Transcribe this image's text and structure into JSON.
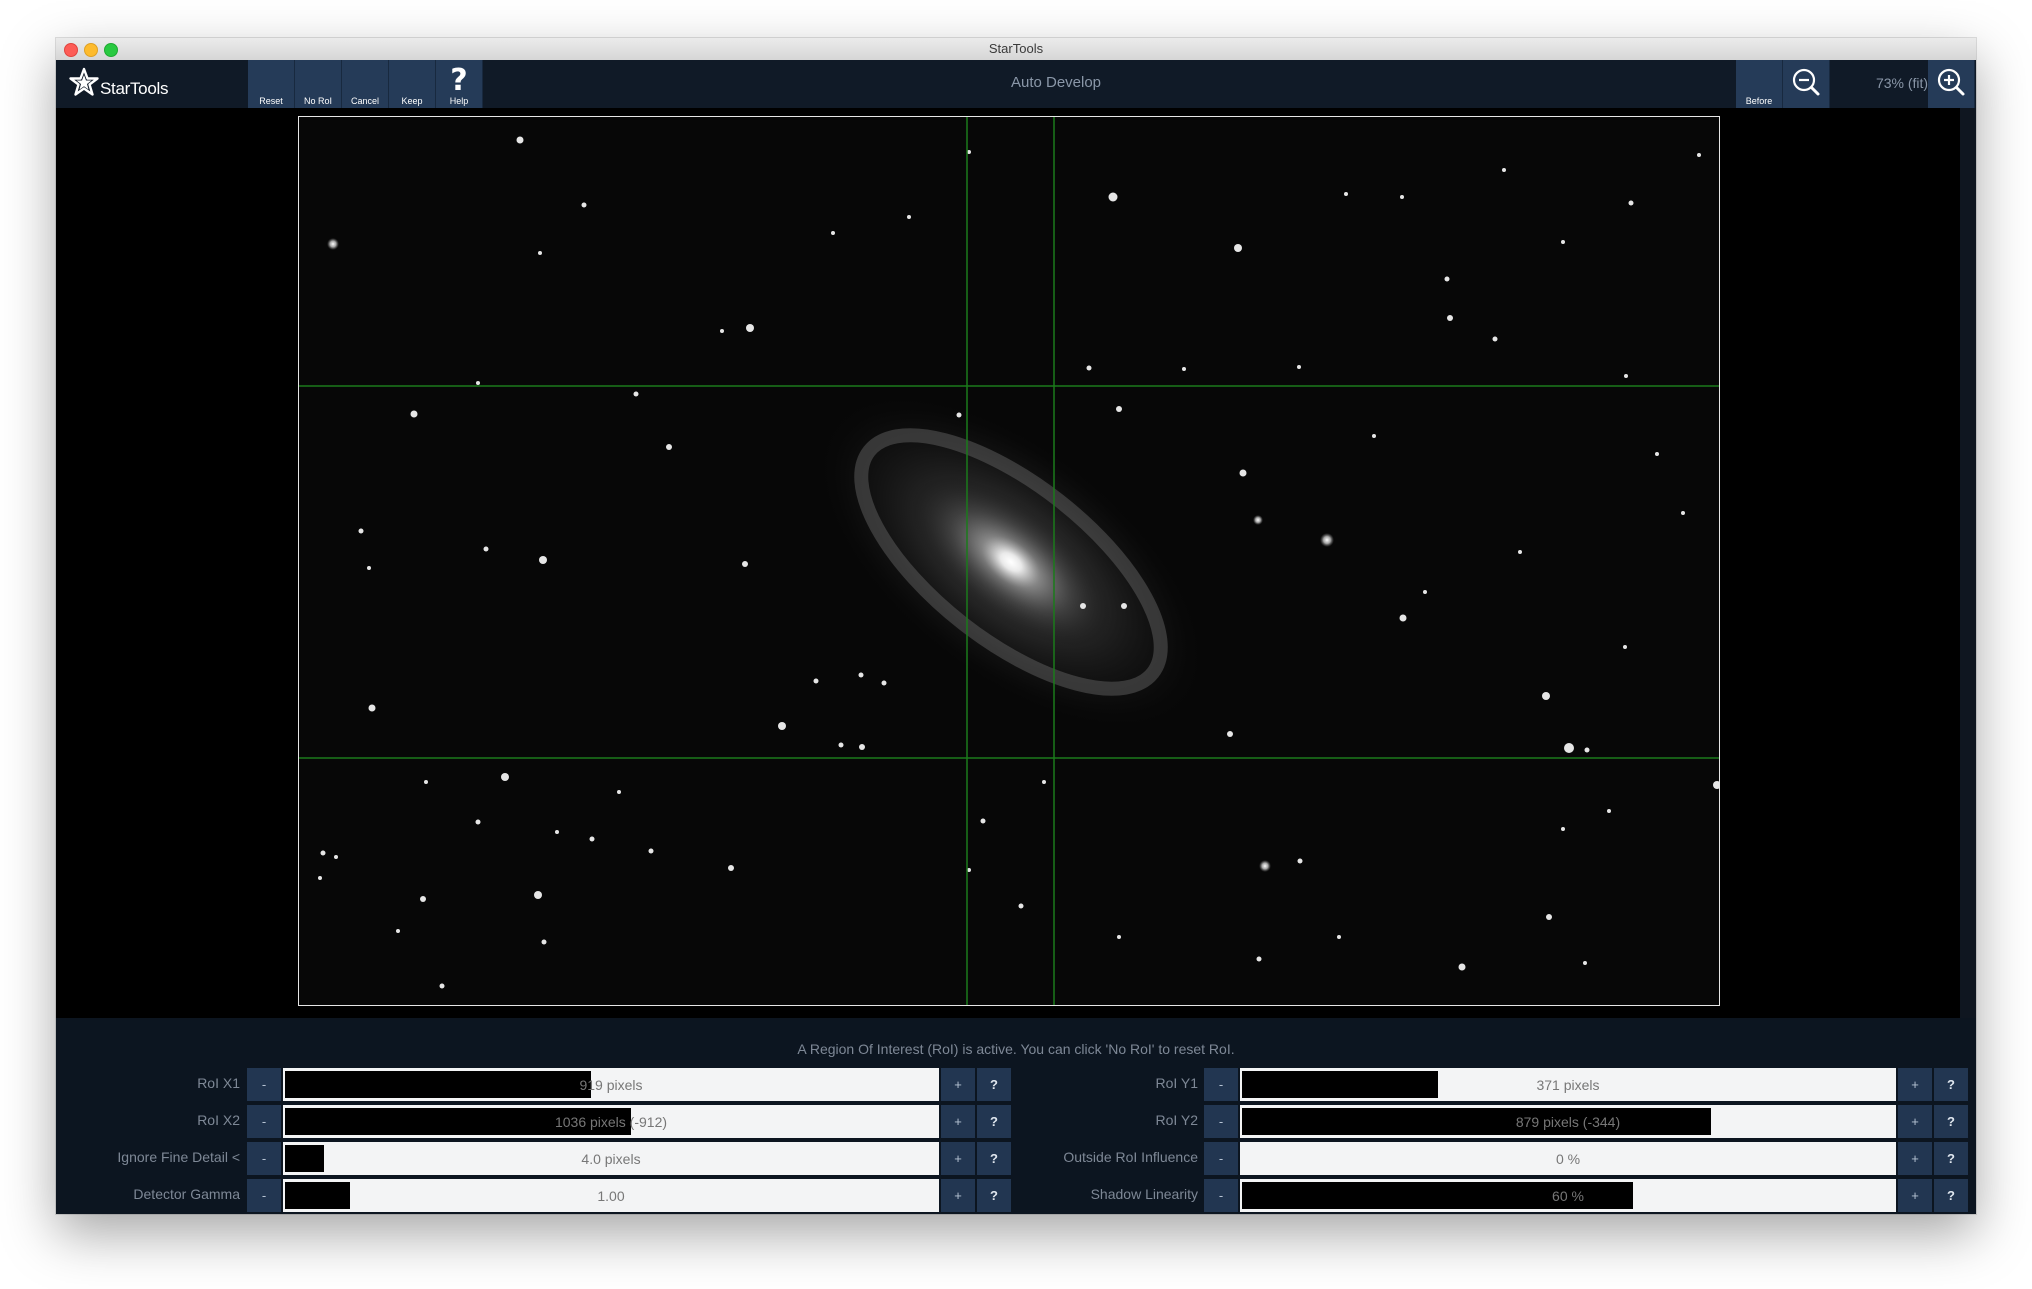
{
  "window": {
    "title": "StarTools"
  },
  "toolbar": {
    "logo_text": "StarTools",
    "buttons": {
      "reset": "Reset",
      "no_roi": "No RoI",
      "cancel": "Cancel",
      "keep": "Keep",
      "help": "Help",
      "before": "Before"
    },
    "tool_title": "Auto Develop",
    "zoom_level": "73% (fit)"
  },
  "status": {
    "message": "A Region Of Interest (RoI) is active. You can click 'No RoI' to reset RoI."
  },
  "params": [
    {
      "label": "RoI X1",
      "value": "919 pixels",
      "level": 0.47
    },
    {
      "label": "RoI X2",
      "value": "1036 pixels (-912)",
      "level": 0.53
    },
    {
      "label": "Ignore Fine Detail <",
      "value": "4.0 pixels",
      "level": 0.06
    },
    {
      "label": "Detector Gamma",
      "value": "1.00",
      "level": 0.1
    },
    {
      "label": "RoI Y1",
      "value": "371 pixels",
      "level": 0.3
    },
    {
      "label": "RoI Y2",
      "value": "879 pixels (-344)",
      "level": 0.72
    },
    {
      "label": "Outside RoI Influence",
      "value": "0 %",
      "level": 0.0
    },
    {
      "label": "Shadow Linearity",
      "value": "60 %",
      "level": 0.6
    }
  ],
  "buttons": {
    "minus": "-",
    "plus": "+",
    "help": "?"
  },
  "icons": {
    "logo": "startools-logo-icon",
    "help": "help-icon",
    "zoom_out": "zoom-out-icon",
    "zoom_in": "zoom-in-icon"
  },
  "colors": {
    "toolbar_bg": "#101a27",
    "button_bg": "#253b58",
    "roi_line": "#1b7a1b"
  }
}
